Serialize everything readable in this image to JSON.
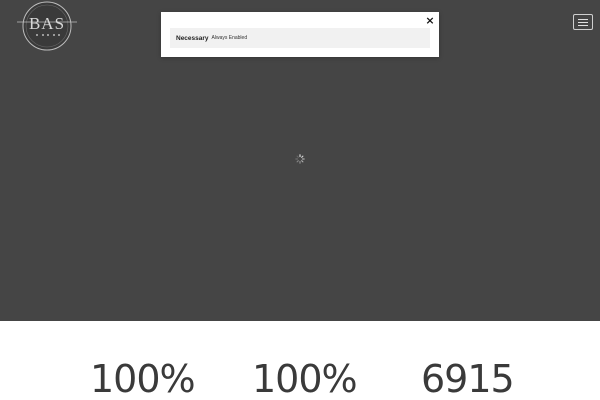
{
  "logo": {
    "mark": "BAS"
  },
  "cookie_modal": {
    "close_label": "×",
    "row_title": "Necessary",
    "row_status": "Always Enabled"
  },
  "stats": [
    {
      "value": "100%"
    },
    {
      "value": "100%"
    },
    {
      "value": "6915"
    }
  ],
  "colors": {
    "hero_bg": "#454545",
    "page_bg": "#ffffff",
    "modal_bg": "#ffffff",
    "row_bg": "#f1f1f1",
    "stat_text": "#3a3a3a"
  },
  "icons": {
    "menu": "hamburger-menu-icon",
    "close": "close-icon",
    "loading": "loading-spinner-icon"
  }
}
